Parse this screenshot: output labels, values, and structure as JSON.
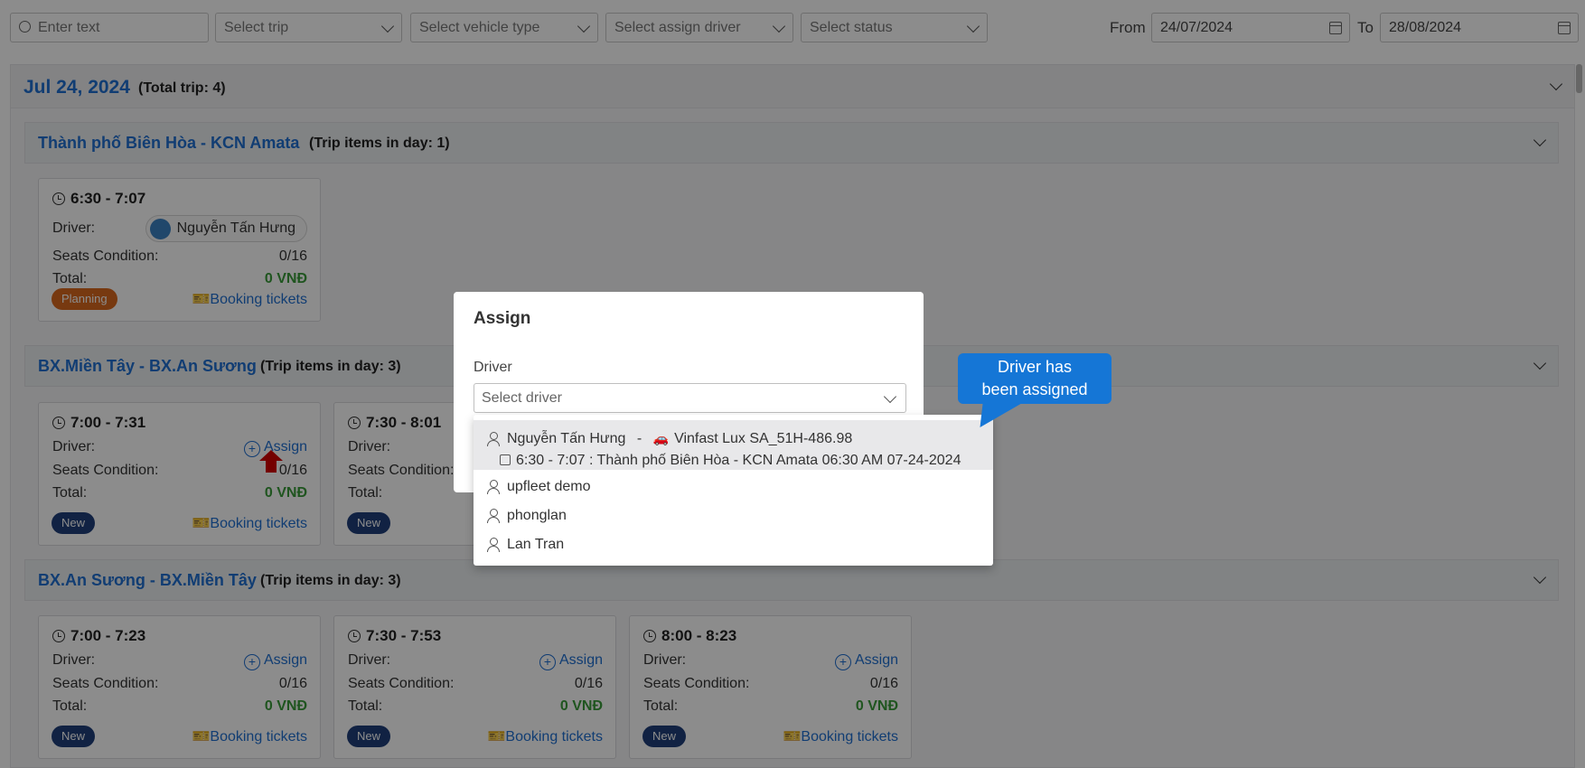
{
  "filters": {
    "search_placeholder": "Enter text",
    "trip_placeholder": "Select trip",
    "vehicle_type_placeholder": "Select vehicle type",
    "assign_driver_placeholder": "Select assign driver",
    "status_placeholder": "Select status",
    "from_label": "From",
    "from_value": "24/07/2024",
    "to_label": "To",
    "to_value": "28/08/2024"
  },
  "day": {
    "title": "Jul 24, 2024",
    "count": "(Total trip: 4)"
  },
  "groups": [
    {
      "title": "Thành phố Biên Hòa - KCN Amata",
      "count": "(Trip items in day: 1)"
    },
    {
      "title": "BX.Miền Tây - BX.An Sương",
      "count": "(Trip items in day: 3)"
    },
    {
      "title": "BX.An Sương - BX.Miền Tây",
      "count": "(Trip items in day: 3)"
    }
  ],
  "labels": {
    "driver": "Driver:",
    "seats": "Seats Condition:",
    "total": "Total:",
    "assign": "Assign",
    "booking": "Booking tickets"
  },
  "cards": [
    {
      "time": "6:30  -  7:07",
      "driver": "Nguyễn Tấn Hưng",
      "seats": "0/16",
      "total": "0 VNĐ",
      "status": "Planning"
    },
    {
      "time": "7:00  -  7:31",
      "seats": "0/16",
      "total": "0 VNĐ",
      "status": "New"
    },
    {
      "time": "7:30  -  8:01",
      "status": "New"
    },
    {
      "time": "7:00  -  7:23",
      "seats": "0/16",
      "total": "0 VNĐ",
      "status": "New"
    },
    {
      "time": "7:30  -  7:53",
      "seats": "0/16",
      "total": "0 VNĐ",
      "status": "New"
    },
    {
      "time": "8:00  -  8:23",
      "seats": "0/16",
      "total": "0 VNĐ",
      "status": "New"
    }
  ],
  "modal": {
    "title": "Assign",
    "driver_label": "Driver",
    "driver_placeholder": "Select driver",
    "options": [
      {
        "name": "Nguyễn Tấn Hưng",
        "separator": "-",
        "vehicle": "Vinfast Lux SA_51H-486.98",
        "schedule": "6:30 - 7:07 : Thành phố Biên Hòa - KCN Amata 06:30 AM 07-24-2024"
      },
      {
        "name": "upfleet demo"
      },
      {
        "name": "phonglan"
      },
      {
        "name": "Lan Tran"
      }
    ]
  },
  "callout": {
    "line1": "Driver has",
    "line2": "been assigned"
  },
  "colors": {
    "accent": "#1f6fd1",
    "badge_new": "#1f3f7a",
    "badge_planning": "#d9681e",
    "callout": "#1576d6",
    "total": "#3a9b3a"
  }
}
